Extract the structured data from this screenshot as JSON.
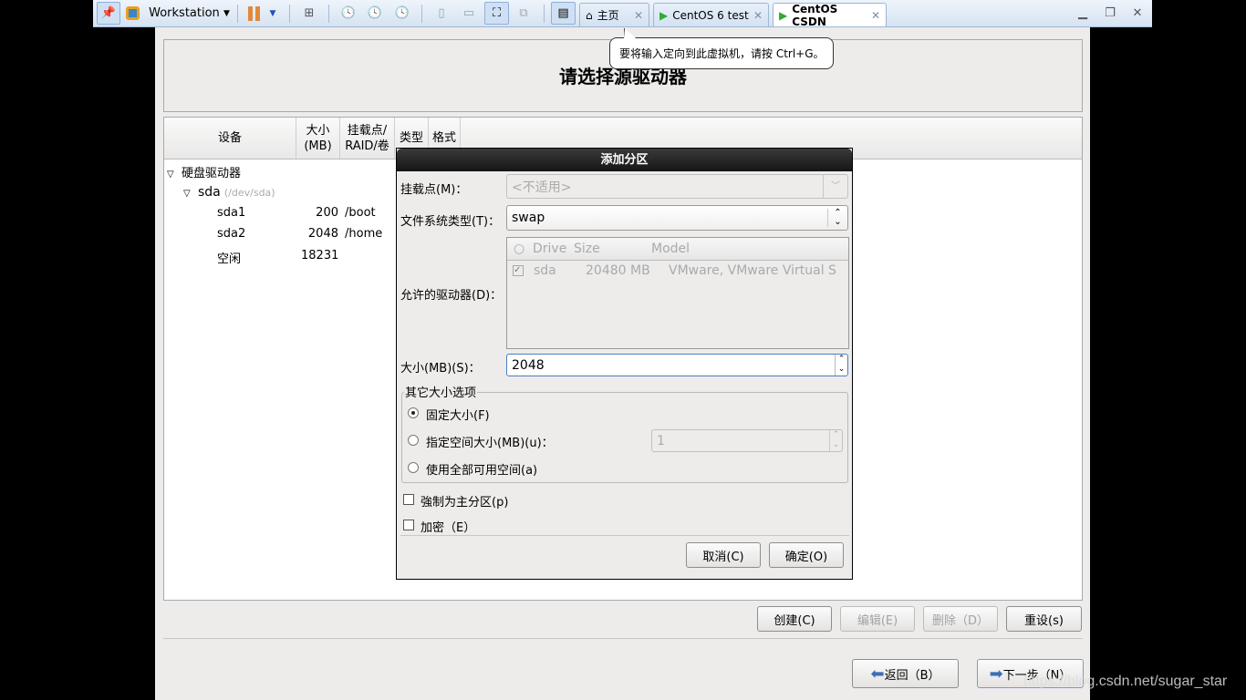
{
  "toolbar": {
    "app_label": "Workstation",
    "icons": [
      "pin-icon",
      "vmware-logo-icon",
      "pause-icon",
      "dropdown-icon",
      "send-keys-icon",
      "snapshot-take-icon",
      "snapshot-revert-icon",
      "snapshot-manager-icon",
      "sidebar-view-icon",
      "console-view-icon",
      "fullscreen-icon",
      "unity-icon",
      "thumbnail-view-icon"
    ]
  },
  "tabs": [
    {
      "label": "主页",
      "icon": "home-icon"
    },
    {
      "label": "CentOS 6 test",
      "icon": "vm-icon"
    },
    {
      "label": "CentOS CSDN",
      "icon": "vm-icon",
      "active": true
    }
  ],
  "tooltip": "要将输入定向到此虚拟机，请按 Ctrl+G。",
  "page": {
    "title": "请选择源驱动器"
  },
  "table": {
    "headers": {
      "device": "设备",
      "size": "大小\n(MB)",
      "mount": "挂载点/\nRAID/卷",
      "type": "类型",
      "format": "格式"
    },
    "tree": {
      "group": "硬盘驱动器",
      "disk": "sda",
      "disk_path": "(/dev/sda)",
      "rows": [
        {
          "device": "sda1",
          "size": "200",
          "mount": "/boot"
        },
        {
          "device": "sda2",
          "size": "2048",
          "mount": "/home"
        },
        {
          "device": "空闲",
          "size": "18231",
          "mount": ""
        }
      ]
    }
  },
  "buttons": {
    "create": "创建(C)",
    "edit": "编辑(E)",
    "delete": "删除（D）",
    "reset": "重设(s)",
    "back": "返回（B）",
    "next": "下一步（N）"
  },
  "dialog": {
    "title": "添加分区",
    "mount_label": "挂载点(M)：",
    "mount_value": "<不适用>",
    "fstype_label": "文件系统类型(T)：",
    "fstype_value": "swap",
    "drives_label": "允许的驱动器(D)：",
    "drives_headers": {
      "drive": "Drive",
      "size": "Size",
      "model": "Model"
    },
    "drives": [
      {
        "checked": true,
        "drive": "sda",
        "size": "20480 MB",
        "model": "VMware, VMware Virtual S"
      }
    ],
    "size_label": "大小(MB)(S)：",
    "size_value": "2048",
    "other_group": "其它大小选项",
    "opt_fixed": "固定大小(F)",
    "opt_upto": "指定空间大小(MB)(u)：",
    "opt_upto_value": "1",
    "opt_fill": "使用全部可用空间(a)",
    "selected_option": "fixed",
    "primary": "強制为主分区(p)",
    "encrypt": "加密（E）",
    "cancel": "取消(C)",
    "ok": "确定(O)"
  },
  "watermark": "https://blog.csdn.net/sugar_star"
}
